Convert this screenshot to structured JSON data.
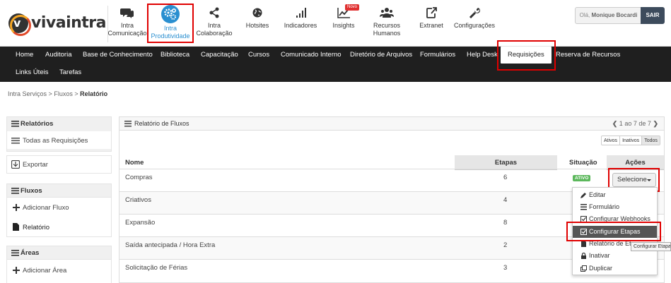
{
  "brand": {
    "name": "vivaintra",
    "logo_letter": "v"
  },
  "apps": [
    {
      "label_lines": [
        "Intra",
        "Comunicação"
      ],
      "icon": "chat-icon"
    },
    {
      "label_lines": [
        "Intra",
        "Produtividade"
      ],
      "icon": "gears-icon",
      "active": true
    },
    {
      "label_lines": [
        "Intra",
        "Colaboração"
      ],
      "icon": "share-icon"
    },
    {
      "label_lines": [
        "Hotsites"
      ],
      "icon": "globe-icon"
    },
    {
      "label_lines": [
        "Indicadores"
      ],
      "icon": "signal-bars-icon"
    },
    {
      "label_lines": [
        "Insights"
      ],
      "icon": "line-chart-icon",
      "badge": "Novo"
    },
    {
      "label_lines": [
        "Recursos",
        "Humanos"
      ],
      "icon": "users-icon"
    },
    {
      "label_lines": [
        "Extranet"
      ],
      "icon": "external-link-icon"
    },
    {
      "label_lines": [
        "Configurações"
      ],
      "icon": "wrench-icon"
    }
  ],
  "user": {
    "greeting": "Olá,",
    "name": "Monique Bocardi",
    "logout_label": "SAIR"
  },
  "nav": {
    "items": [
      "Home",
      "Auditoria",
      "Base de Conhecimento",
      "Biblioteca",
      "Capacitação",
      "Cursos",
      "Comunicado Interno",
      "Diretório de Arquivos",
      "Formulários",
      "Help Desk",
      "Requisições",
      "Reserva de Recursos",
      "Links Úteis",
      "Tarefas"
    ],
    "active": "Requisições"
  },
  "breadcrumb": {
    "items": [
      "Intra Serviços",
      "Fluxos"
    ],
    "current": "Relatório",
    "sep": ">"
  },
  "sidebar": {
    "relatorios_title": "Relatórios",
    "todas": "Todas as Requisições",
    "exportar": "Exportar",
    "fluxos_title": "Fluxos",
    "adicionar_fluxo": "Adicionar Fluxo",
    "relatorio": "Relatório",
    "areas_title": "Áreas",
    "adicionar_area": "Adicionar Área"
  },
  "panel": {
    "title": "Relatório de Fluxos",
    "pager": {
      "from": "1",
      "to": "7",
      "of_word": "ao",
      "de_word": "de",
      "total": "7"
    },
    "filters": [
      "Ativos",
      "Inativos",
      "Todos"
    ],
    "columns": {
      "name": "Nome",
      "steps": "Etapas",
      "status": "Situação",
      "actions": "Ações"
    },
    "rows": [
      {
        "name": "Compras",
        "steps": "6",
        "status": "ATIVO"
      },
      {
        "name": "Criativos",
        "steps": "4"
      },
      {
        "name": "Expansão",
        "steps": "8"
      },
      {
        "name": "Saída antecipada / Hora Extra",
        "steps": "2"
      },
      {
        "name": "Solicitação de Férias",
        "steps": "3"
      }
    ],
    "select_label": "Selecione"
  },
  "dropdown": {
    "items": [
      {
        "label": "Editar",
        "icon": "pencil-icon"
      },
      {
        "label": "Formulário",
        "icon": "list-icon"
      },
      {
        "label": "Configurar Webhooks",
        "icon": "checkbox-icon"
      },
      {
        "label": "Configurar Etapas",
        "icon": "checkbox-icon",
        "selected": true
      },
      {
        "label": "Relatório de Et",
        "icon": "file-icon"
      },
      {
        "label": "Inativar",
        "icon": "lock-icon"
      },
      {
        "label": "Duplicar",
        "icon": "copy-icon"
      }
    ]
  },
  "tooltip": "Configurar Etapas",
  "colors": {
    "accent": "#2a8fd0",
    "nav_bg": "#1f1f1f",
    "highlight": "#e00000",
    "active_badge": "#5cb85c",
    "logout_bg": "#3d4b5c"
  }
}
